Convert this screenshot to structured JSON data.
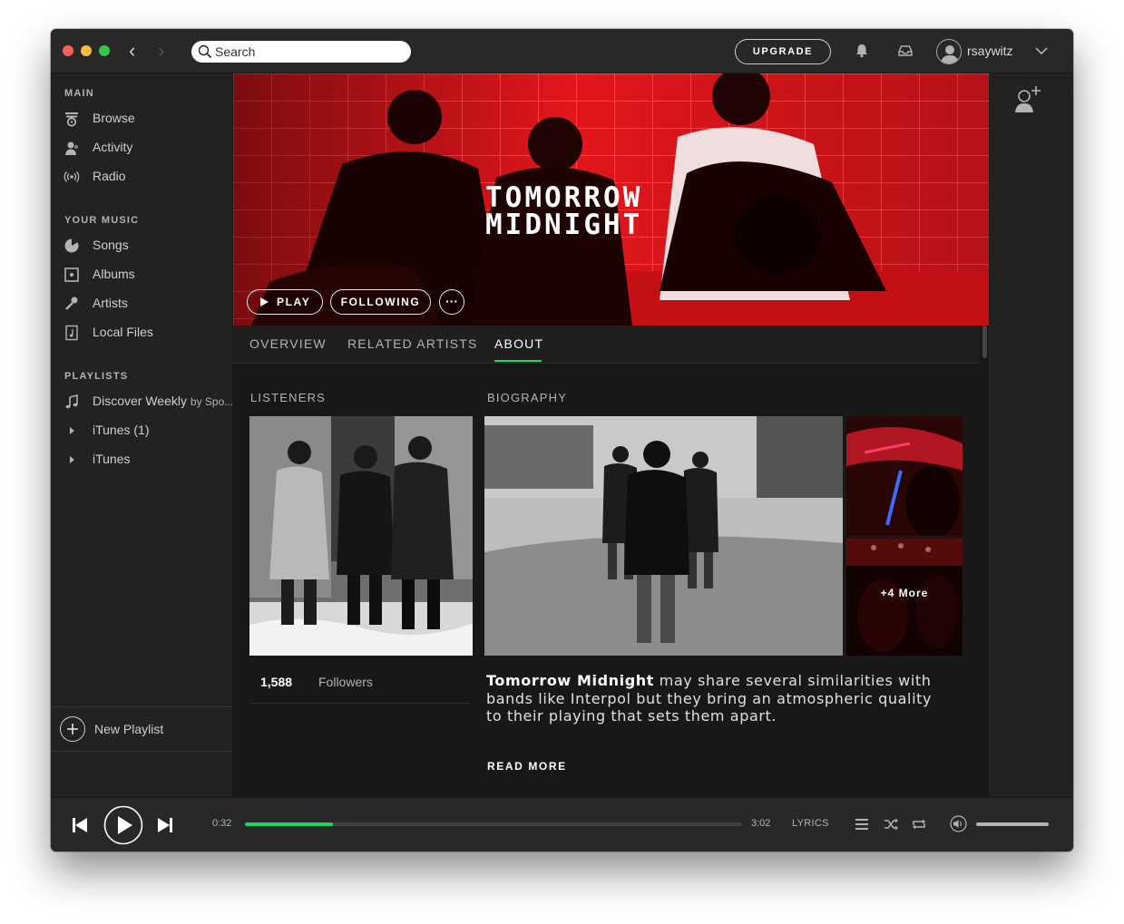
{
  "window": {
    "search_placeholder": "Search",
    "upgrade_label": "UPGRADE",
    "username": "rsaywitz"
  },
  "sidebar": {
    "main_title": "MAIN",
    "main_items": [
      {
        "label": "Browse",
        "icon": "browse-icon"
      },
      {
        "label": "Activity",
        "icon": "activity-icon"
      },
      {
        "label": "Radio",
        "icon": "radio-icon"
      }
    ],
    "music_title": "YOUR MUSIC",
    "music_items": [
      {
        "label": "Songs",
        "icon": "songs-icon"
      },
      {
        "label": "Albums",
        "icon": "albums-icon"
      },
      {
        "label": "Artists",
        "icon": "artists-icon"
      },
      {
        "label": "Local Files",
        "icon": "local-files-icon"
      }
    ],
    "playlists_title": "PLAYLISTS",
    "playlists": [
      {
        "label": "Discover Weekly",
        "suffix": "by Spo...",
        "icon": "music-note-icon"
      },
      {
        "label": "iTunes (1)",
        "icon": "disclosure-triangle-icon"
      },
      {
        "label": "iTunes",
        "icon": "disclosure-triangle-icon"
      }
    ],
    "new_playlist_label": "New Playlist"
  },
  "artist": {
    "logo_line1": "TOMORROW",
    "logo_line2": "MIDNIGHT",
    "play_label": "PLAY",
    "following_label": "FOLLOWING",
    "more_label": "···",
    "hero_color": "#e0141b"
  },
  "tabs": {
    "items": [
      "OVERVIEW",
      "RELATED ARTISTS",
      "ABOUT"
    ],
    "active": "ABOUT",
    "accent": "#1ed760"
  },
  "about": {
    "listeners_heading": "LISTENERS",
    "biography_heading": "BIOGRAPHY",
    "followers_count": "1,588",
    "followers_label": "Followers",
    "more_photos_label": "+4 More",
    "bio_name": "Tomorrow Midnight",
    "bio_rest": " may share several similarities with bands like Interpol but they bring an atmospheric quality to their playing that sets them apart.",
    "read_more_label": "READ MORE"
  },
  "player": {
    "elapsed": "0:32",
    "total": "3:02",
    "progress_fraction": 0.177,
    "lyrics_label": "LYRICS",
    "volume_fraction": 1.0
  }
}
